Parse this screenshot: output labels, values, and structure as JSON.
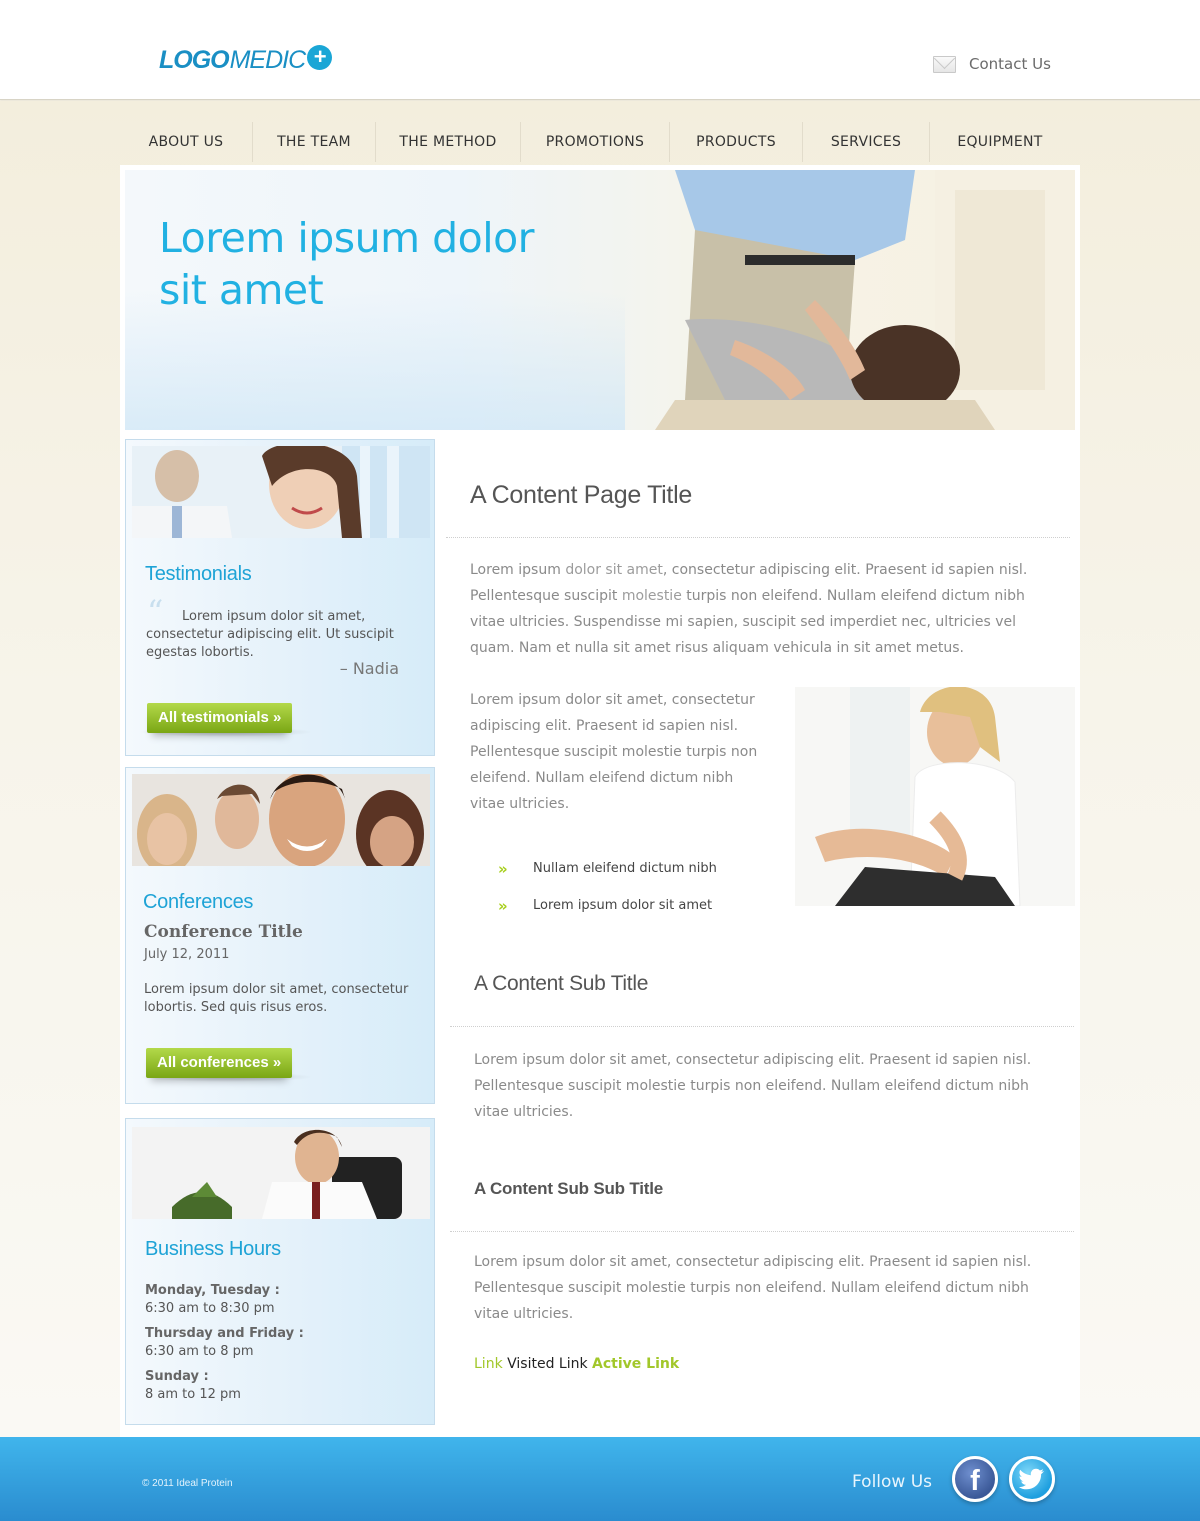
{
  "header": {
    "logo_part1": "LOGO",
    "logo_part2": "MEDIC",
    "logo_plus": "+",
    "contact_label": "Contact Us",
    "contact_icon": "mail-icon"
  },
  "nav": {
    "items": [
      "ABOUT US",
      "THE TEAM",
      "THE METHOD",
      "PROMOTIONS",
      "PRODUCTS",
      "SERVICES",
      "EQUIPMENT"
    ]
  },
  "hero": {
    "title": "Lorem ipsum dolor sit amet"
  },
  "sidebar": {
    "testimonials": {
      "title": "Testimonials",
      "quote_mark": "“",
      "quote": "Lorem ipsum dolor sit amet, consectetur adipiscing elit. Ut suscipit egestas lobortis.",
      "author": "– Nadia",
      "button": "All testimonials »"
    },
    "conferences": {
      "title": "Conferences",
      "item_title": "Conference Title",
      "item_date": "July 12, 2011",
      "item_text": "Lorem ipsum dolor sit amet, consectetur lobortis. Sed quis risus eros.",
      "button": "All conferences »"
    },
    "business_hours": {
      "title": "Business Hours",
      "entries": [
        {
          "label": "Monday, Tuesday :",
          "value": "6:30 am to 8:30 pm"
        },
        {
          "label": "Thursday and Friday :",
          "value": "6:30 am to 8 pm"
        },
        {
          "label": "Sunday :",
          "value": "8 am to 12 pm"
        }
      ]
    }
  },
  "content": {
    "page_title": "A Content Page Title",
    "intro_part1": "Lorem ipsum ",
    "intro_part2": "dolor sit amet",
    "intro_part3": ", consectetur adipiscing elit. Praesent id sapien nisl. Pellentesque suscipit ",
    "intro_part4": "molestie",
    "intro_part5": " turpis non eleifend. Nullam eleifend dictum nibh vitae ultricies. Suspendisse mi sapien, suscipit sed imperdiet nec, ultricies vel quam. Nam et nulla sit amet risus aliquam vehicula in sit amet metus.",
    "side_paragraph": "Lorem ipsum dolor sit amet, consectetur adipiscing elit. Praesent id sapien nisl. Pellentesque suscipit molestie turpis non eleifend. Nullam eleifend dictum nibh vitae ultricies.",
    "bullets": [
      "Nullam eleifend dictum nibh",
      "Lorem ipsum dolor sit amet"
    ],
    "bullet_icon": "»",
    "sub_title": "A Content Sub Title",
    "sub_paragraph": "Lorem ipsum dolor sit amet, consectetur adipiscing elit. Praesent id sapien nisl. Pellentesque suscipit molestie turpis non eleifend. Nullam eleifend dictum nibh vitae ultricies.",
    "sub_sub_title": "A Content Sub Sub Title",
    "sub_sub_paragraph": "Lorem ipsum dolor sit amet, consectetur adipiscing elit. Praesent id sapien nisl. Pellentesque suscipit molestie turpis non eleifend. Nullam eleifend dictum nibh vitae ultricies.",
    "link_label": "Link",
    "visited_link_label": "Visited Link",
    "active_link_label": "Active Link"
  },
  "footer": {
    "copyright": "© 2011 Ideal Protein",
    "follow_label": "Follow Us",
    "facebook_glyph": "f",
    "social_icons": [
      "facebook-icon",
      "twitter-icon"
    ]
  },
  "colors": {
    "accent_blue": "#21b1e2",
    "accent_green": "#a2c72a",
    "footer_blue": "#2a8ccf"
  }
}
